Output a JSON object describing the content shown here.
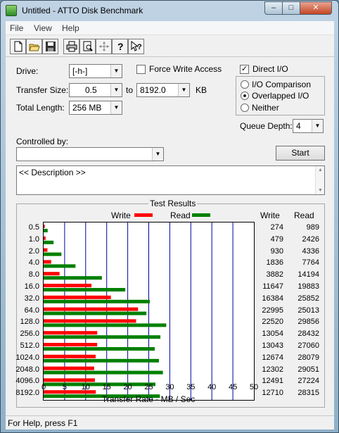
{
  "window": {
    "title": "Untitled - ATTO Disk Benchmark",
    "minimize": "–",
    "maximize": "□",
    "close": "✕"
  },
  "menu": [
    "File",
    "View",
    "Help"
  ],
  "toolbar": [
    "new-icon",
    "open-icon",
    "save-icon",
    "print-icon",
    "print-preview-icon",
    "move-icon",
    "help-icon",
    "context-help-icon"
  ],
  "settings": {
    "drive_label": "Drive:",
    "drive_value": "[-h-]",
    "force_write_label": "Force Write Access",
    "direct_io_label": "Direct I/O",
    "direct_io_checked": true,
    "transfer_size_label": "Transfer Size:",
    "transfer_from": "0.5",
    "to_label": "to",
    "transfer_to": "8192.0",
    "kb_label": "KB",
    "total_length_label": "Total Length:",
    "total_length_value": "256 MB",
    "io_comparison_label": "I/O Comparison",
    "overlapped_label": "Overlapped I/O",
    "neither_label": "Neither",
    "queue_depth_label": "Queue Depth:",
    "queue_depth_value": "4",
    "controlled_by_label": "Controlled by:",
    "controlled_by_value": "",
    "start_label": "Start",
    "description": "<< Description >>"
  },
  "results": {
    "title": "Test Results",
    "legend_write": "Write",
    "legend_read": "Read",
    "col_write": "Write",
    "col_read": "Read",
    "colors": {
      "write": "#ff0000",
      "read": "#008000",
      "grid": "#0000a0"
    }
  },
  "chart_data": {
    "type": "bar",
    "orientation": "horizontal",
    "xlabel": "Transfer Rate - MB / Sec",
    "xlim": [
      0,
      50
    ],
    "xticks": [
      "0",
      "5",
      "10",
      "15",
      "20",
      "25",
      "30",
      "35",
      "40",
      "45",
      "50"
    ],
    "categories": [
      "0.5",
      "1.0",
      "2.0",
      "4.0",
      "8.0",
      "16.0",
      "32.0",
      "64.0",
      "128.0",
      "256.0",
      "512.0",
      "1024.0",
      "2048.0",
      "4096.0",
      "8192.0"
    ],
    "series": [
      {
        "name": "Write",
        "values_kb": [
          274,
          479,
          930,
          1836,
          3882,
          11647,
          16384,
          22995,
          22520,
          13054,
          13043,
          12674,
          12302,
          12491,
          12710
        ]
      },
      {
        "name": "Read",
        "values_kb": [
          989,
          2426,
          4336,
          7764,
          14194,
          19883,
          25852,
          25013,
          29856,
          28432,
          27060,
          28079,
          29051,
          27224,
          28315
        ]
      }
    ],
    "write_text": [
      "274",
      "479",
      "930",
      "1836",
      "3882",
      "11647",
      "16384",
      "22995",
      "22520",
      "13054",
      "13043",
      "12674",
      "12302",
      "12491",
      "12710"
    ],
    "read_text": [
      "989",
      "2426",
      "4336",
      "7764",
      "14194",
      "19883",
      "25852",
      "25013",
      "29856",
      "28432",
      "27060",
      "28079",
      "29051",
      "27224",
      "28315"
    ]
  },
  "status": {
    "text": "For Help, press F1"
  }
}
